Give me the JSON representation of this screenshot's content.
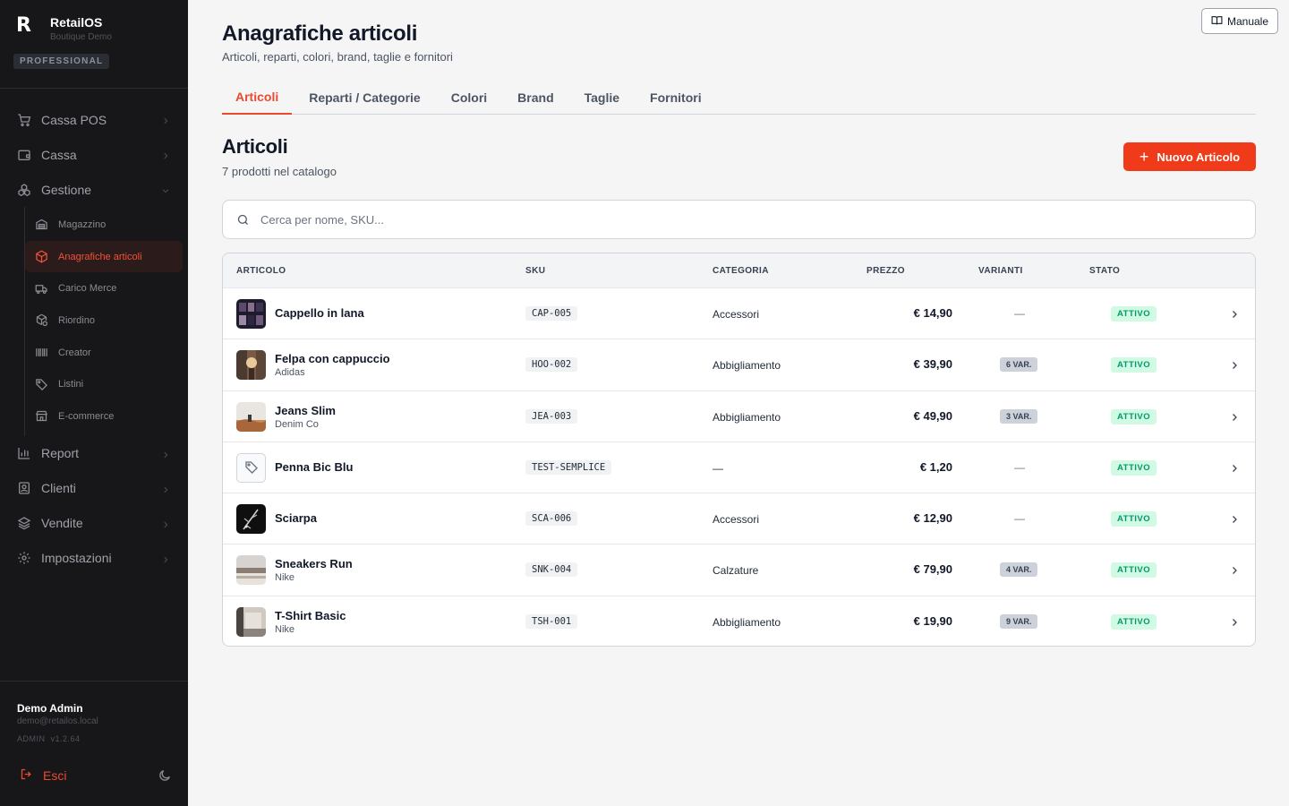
{
  "sidebar": {
    "brand_logo": "R",
    "brand_name": "RetailOS",
    "brand_sub": "Boutique Demo",
    "plan": "PROFESSIONAL",
    "nav": [
      {
        "label": "Cassa POS",
        "icon": "cart-icon"
      },
      {
        "label": "Cassa",
        "icon": "wallet-icon"
      },
      {
        "label": "Gestione",
        "icon": "boxes-icon",
        "expanded": true
      }
    ],
    "subnav": [
      {
        "label": "Magazzino",
        "icon": "warehouse-icon"
      },
      {
        "label": "Anagrafiche articoli",
        "icon": "package-icon",
        "active": true
      },
      {
        "label": "Carico Merce",
        "icon": "truck-icon"
      },
      {
        "label": "Riordino",
        "icon": "package-refresh-icon"
      },
      {
        "label": "Creator",
        "icon": "barcode-icon"
      },
      {
        "label": "Listini",
        "icon": "tag-icon"
      },
      {
        "label": "E-commerce",
        "icon": "store-icon"
      }
    ],
    "nav_bottom": [
      {
        "label": "Report",
        "icon": "bar-chart-icon"
      },
      {
        "label": "Clienti",
        "icon": "contact-icon"
      },
      {
        "label": "Vendite",
        "icon": "layers-icon"
      },
      {
        "label": "Impostazioni",
        "icon": "settings-icon"
      }
    ],
    "user": {
      "name": "Demo Admin",
      "email": "demo@retailos.local",
      "role": "ADMIN",
      "version": "v1.2.64"
    },
    "logout_label": "Esci"
  },
  "header": {
    "manual_label": "Manuale",
    "title": "Anagrafiche articoli",
    "subtitle": "Articoli, reparti, colori, brand, taglie e fornitori"
  },
  "tabs": [
    {
      "label": "Articoli",
      "active": true
    },
    {
      "label": "Reparti / Categorie"
    },
    {
      "label": "Colori"
    },
    {
      "label": "Brand"
    },
    {
      "label": "Taglie"
    },
    {
      "label": "Fornitori"
    }
  ],
  "section": {
    "title": "Articoli",
    "subtitle": "7 prodotti nel catalogo",
    "new_button": "Nuovo Articolo",
    "new_plus": "+",
    "search_placeholder": "Cerca per nome, SKU..."
  },
  "table": {
    "columns": {
      "articolo": "ARTICOLO",
      "sku": "SKU",
      "categoria": "CATEGORIA",
      "prezzo": "PREZZO",
      "varianti": "VARIANTI",
      "stato": "STATO"
    },
    "rows": [
      {
        "name": "Cappello in lana",
        "brand": "",
        "sku": "CAP-005",
        "category": "Accessori",
        "price": "€ 14,90",
        "variants": "—",
        "status": "ATTIVO",
        "thumb": "dark-grid"
      },
      {
        "name": "Felpa con cappuccio",
        "brand": "Adidas",
        "sku": "HOO-002",
        "category": "Abbigliamento",
        "price": "€ 39,90",
        "variants": "6 VAR.",
        "status": "ATTIVO",
        "thumb": "street"
      },
      {
        "name": "Jeans Slim",
        "brand": "Denim Co",
        "sku": "JEA-003",
        "category": "Abbigliamento",
        "price": "€ 49,90",
        "variants": "3 VAR.",
        "status": "ATTIVO",
        "thumb": "desert"
      },
      {
        "name": "Penna Bic Blu",
        "brand": "",
        "sku": "TEST-SEMPLICE",
        "category": "—",
        "price": "€ 1,20",
        "variants": "—",
        "status": "ATTIVO",
        "thumb": "tag"
      },
      {
        "name": "Sciarpa",
        "brand": "",
        "sku": "SCA-006",
        "category": "Accessori",
        "price": "€ 12,90",
        "variants": "—",
        "status": "ATTIVO",
        "thumb": "dark-plant"
      },
      {
        "name": "Sneakers Run",
        "brand": "Nike",
        "sku": "SNK-004",
        "category": "Calzature",
        "price": "€ 79,90",
        "variants": "4 VAR.",
        "status": "ATTIVO",
        "thumb": "landscape"
      },
      {
        "name": "T-Shirt Basic",
        "brand": "Nike",
        "sku": "TSH-001",
        "category": "Abbigliamento",
        "price": "€ 19,90",
        "variants": "9 VAR.",
        "status": "ATTIVO",
        "thumb": "room"
      }
    ]
  },
  "colors": {
    "accent": "#f03b1a",
    "sidebar_bg": "#17171a",
    "active_bg": "#2b1b1a",
    "status_bg": "#d1fae5",
    "status_text": "#059669"
  }
}
